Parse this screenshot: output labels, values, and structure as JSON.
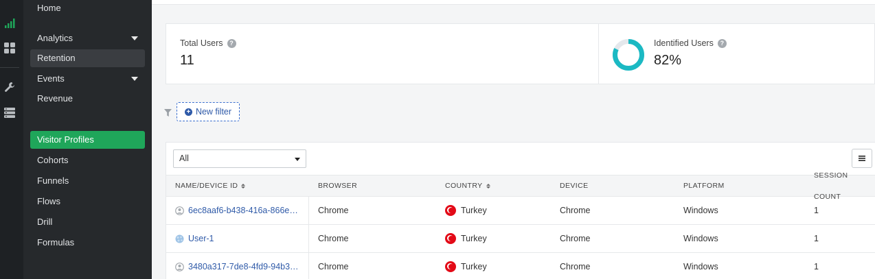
{
  "rail": {
    "icons": [
      "bar-chart-icon",
      "dashboard-grid-icon",
      "wrench-icon",
      "database-icon"
    ]
  },
  "sidebar": {
    "items": [
      {
        "label": "Home"
      },
      {
        "label": "Analytics"
      },
      {
        "label": "Retention"
      },
      {
        "label": "Events"
      },
      {
        "label": "Revenue"
      },
      {
        "label": "Visitor Profiles"
      },
      {
        "label": "Cohorts"
      },
      {
        "label": "Funnels"
      },
      {
        "label": "Flows"
      },
      {
        "label": "Drill"
      },
      {
        "label": "Formulas"
      }
    ]
  },
  "stats": {
    "total_users": {
      "label": "Total Users",
      "value": "11"
    },
    "identified_users": {
      "label": "Identified Users",
      "value": "82%",
      "fraction": 0.82
    }
  },
  "filter": {
    "new_filter_label": "New filter"
  },
  "table": {
    "segment_select": "All",
    "columns": [
      "NAME/DEVICE ID",
      "BROWSER",
      "COUNTRY",
      "DEVICE",
      "PLATFORM",
      "SESSION COUNT"
    ],
    "rows": [
      {
        "name": "6ec8aaf6-b438-416a-866e…",
        "browser": "Chrome",
        "country": "Turkey",
        "device": "Chrome",
        "platform": "Windows",
        "sessions": "1",
        "avatar": "anonymous-user-icon"
      },
      {
        "name": "User-1",
        "browser": "Chrome",
        "country": "Turkey",
        "device": "Chrome",
        "platform": "Windows",
        "sessions": "1",
        "avatar": "identified-user-icon"
      },
      {
        "name": "3480a317-7de8-4fd9-94b3…",
        "browser": "Chrome",
        "country": "Turkey",
        "device": "Chrome",
        "platform": "Windows",
        "sessions": "1",
        "avatar": "anonymous-user-icon"
      }
    ]
  },
  "colors": {
    "accent_green": "#1fa65a",
    "link_blue": "#2f5aa8",
    "donut_teal": "#1bb9c3",
    "sidebar_bg": "#26292c"
  }
}
